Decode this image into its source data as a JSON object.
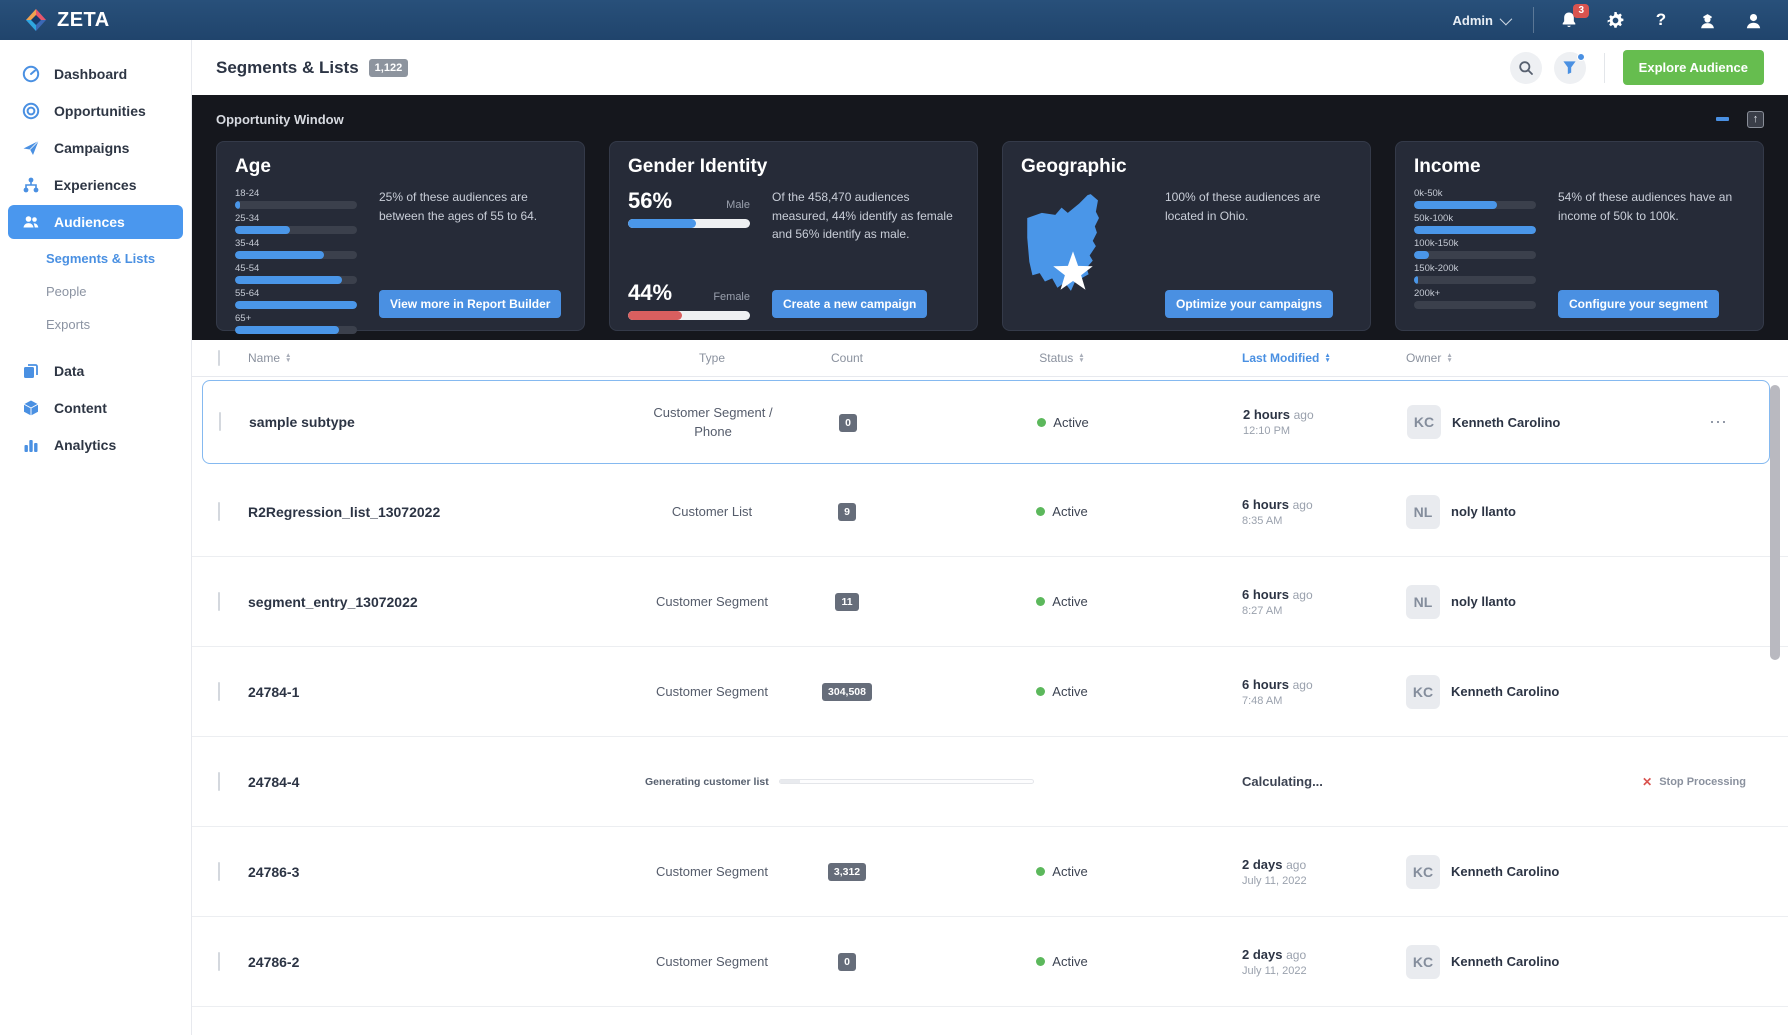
{
  "colors": {
    "accent_blue": "#4A90E2",
    "brand_navy": "#234A72",
    "green_button": "#66BD4F",
    "status_green": "#5CB85C",
    "alert_red": "#D9534F",
    "dark_panel": "#15171D",
    "card_bg": "#262B38"
  },
  "topbar": {
    "brand": "ZETA",
    "admin_label": "Admin",
    "notification_badge": "3"
  },
  "sidebar": {
    "items": [
      {
        "label": "Dashboard"
      },
      {
        "label": "Opportunities"
      },
      {
        "label": "Campaigns"
      },
      {
        "label": "Experiences"
      },
      {
        "label": "Audiences"
      },
      {
        "label": "Data"
      },
      {
        "label": "Content"
      },
      {
        "label": "Analytics"
      }
    ],
    "audiences_children": [
      {
        "label": "Segments & Lists"
      },
      {
        "label": "People"
      },
      {
        "label": "Exports"
      }
    ]
  },
  "header": {
    "title": "Segments & Lists",
    "count_badge": "1,122",
    "explore_button": "Explore Audience"
  },
  "opportunity": {
    "title": "Opportunity Window",
    "cards": {
      "age": {
        "title": "Age",
        "bars": [
          {
            "label": "18-24",
            "value": 4
          },
          {
            "label": "25-34",
            "value": 45
          },
          {
            "label": "35-44",
            "value": 73
          },
          {
            "label": "45-54",
            "value": 88
          },
          {
            "label": "55-64",
            "value": 100
          },
          {
            "label": "65+",
            "value": 85
          }
        ],
        "description": "25% of these audiences are between the ages of 55 to 64.",
        "button": "View more in Report Builder"
      },
      "gender": {
        "title": "Gender Identity",
        "male_pct": "56%",
        "male_label": "Male",
        "male_value": 56,
        "female_pct": "44%",
        "female_label": "Female",
        "female_value": 44,
        "description": "Of the 458,470 audiences measured, 44% identify as female and 56% identify as male.",
        "button": "Create a new campaign"
      },
      "geo": {
        "title": "Geographic",
        "description": "100% of these audiences are located in Ohio.",
        "button": "Optimize your campaigns"
      },
      "income": {
        "title": "Income",
        "bars": [
          {
            "label": "0k-50k",
            "value": 68
          },
          {
            "label": "50k-100k",
            "value": 100
          },
          {
            "label": "100k-150k",
            "value": 12
          },
          {
            "label": "150k-200k",
            "value": 3
          },
          {
            "label": "200k+",
            "value": 0
          }
        ],
        "description": "54% of these audiences have an income of 50k to 100k.",
        "button": "Configure your segment"
      }
    }
  },
  "table": {
    "columns": {
      "name": "Name",
      "type": "Type",
      "count": "Count",
      "status": "Status",
      "modified": "Last Modified",
      "owner": "Owner"
    },
    "rows": [
      {
        "name": "sample subtype",
        "type": "Customer Segment / Phone",
        "count": "0",
        "status": "Active",
        "modified": "2 hours",
        "modified_ago": "ago",
        "modified_detail": "12:10 PM",
        "owner_initials": "KC",
        "owner_name": "Kenneth Carolino",
        "more": "⋯"
      },
      {
        "name": "R2Regression_list_13072022",
        "type": "Customer List",
        "count": "9",
        "status": "Active",
        "modified": "6 hours",
        "modified_ago": "ago",
        "modified_detail": "8:35 AM",
        "owner_initials": "NL",
        "owner_name": "noly llanto"
      },
      {
        "name": "segment_entry_13072022",
        "type": "Customer Segment",
        "count": "11",
        "status": "Active",
        "modified": "6 hours",
        "modified_ago": "ago",
        "modified_detail": "8:27 AM",
        "owner_initials": "NL",
        "owner_name": "noly llanto"
      },
      {
        "name": "24784-1",
        "type": "Customer Segment",
        "count": "304,508",
        "status": "Active",
        "modified": "6 hours",
        "modified_ago": "ago",
        "modified_detail": "7:48 AM",
        "owner_initials": "KC",
        "owner_name": "Kenneth Carolino"
      },
      {
        "name": "24784-4",
        "processing_label": "Generating customer list",
        "processing_value": 8,
        "modified": "Calculating...",
        "stop_x": "✕",
        "stop_action": "Stop Processing"
      },
      {
        "name": "24786-3",
        "type": "Customer Segment",
        "count": "3,312",
        "status": "Active",
        "modified": "2 days",
        "modified_ago": "ago",
        "modified_detail": "July 11, 2022",
        "owner_initials": "KC",
        "owner_name": "Kenneth Carolino"
      },
      {
        "name": "24786-2",
        "type": "Customer Segment",
        "count": "0",
        "status": "Active",
        "modified": "2 days",
        "modified_ago": "ago",
        "modified_detail": "July 11, 2022",
        "owner_initials": "KC",
        "owner_name": "Kenneth Carolino"
      }
    ]
  }
}
